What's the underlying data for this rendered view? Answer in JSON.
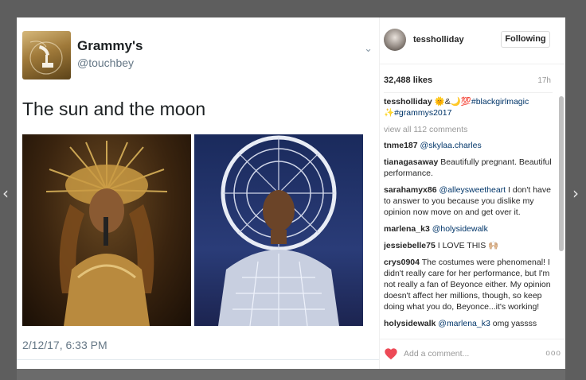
{
  "nav": {
    "prev": "‹",
    "next": "›"
  },
  "tweet": {
    "name": "Grammy's",
    "handle": "@touchbey",
    "chevron": "⌄",
    "text": "The sun and the moon",
    "date": "2/12/17, 6:33 PM"
  },
  "ig": {
    "username": "tessholliday",
    "follow_label": "Following",
    "likes": "32,488 likes",
    "time": "17h",
    "caption": {
      "user": "tessholliday",
      "text_a": " 🌞&🌙💯",
      "tag1": "#blackgirlmagic",
      "text_b": " ✨",
      "tag2": "#grammys2017"
    },
    "view_all": "view all 112 comments",
    "comments": [
      {
        "user": "tnme187",
        "mention": "@skylaa.charles",
        "text": ""
      },
      {
        "user": "tianagasaway",
        "mention": "",
        "text": " Beautifully pregnant. Beautiful performance."
      },
      {
        "user": "sarahamyx86",
        "mention": "@alleysweetheart",
        "text": " I don't have to answer to you because you dislike my opinion now move on and get over it."
      },
      {
        "user": "marlena_k3",
        "mention": "@holysidewalk",
        "text": ""
      },
      {
        "user": "jessiebelle75",
        "mention": "",
        "text": " I LOVE THIS 🙌🏼"
      },
      {
        "user": "crys0904",
        "mention": "",
        "text": " The costumes were phenomenal! I didn't really care for her performance, but I'm not really a fan of Beyonce either. My opinion doesn't affect her millions, though, so keep doing what you do, Beyonce...it's working!"
      },
      {
        "user": "holysidewalk",
        "mention": "@marlena_k3",
        "text": " omg yassss"
      }
    ],
    "add_comment_placeholder": "Add a comment...",
    "more": "ooo",
    "heart_color": "#ed4956"
  },
  "colors": {
    "backdrop": "#5e5e5e",
    "link": "#003569"
  }
}
